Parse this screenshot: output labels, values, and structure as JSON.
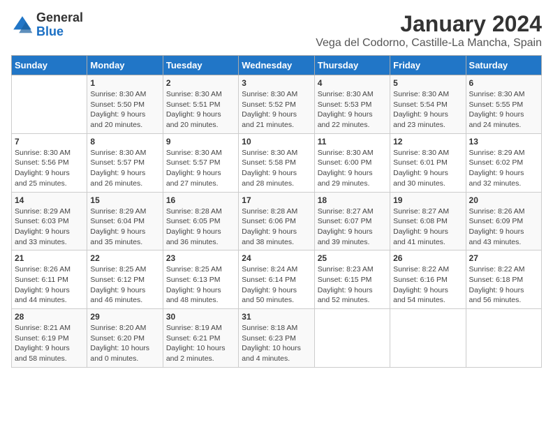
{
  "logo": {
    "line1": "General",
    "line2": "Blue"
  },
  "title": "January 2024",
  "subtitle": "Vega del Codorno, Castille-La Mancha, Spain",
  "weekdays": [
    "Sunday",
    "Monday",
    "Tuesday",
    "Wednesday",
    "Thursday",
    "Friday",
    "Saturday"
  ],
  "weeks": [
    [
      {
        "day": "",
        "sunrise": "",
        "sunset": "",
        "daylight": ""
      },
      {
        "day": "1",
        "sunrise": "Sunrise: 8:30 AM",
        "sunset": "Sunset: 5:50 PM",
        "daylight": "Daylight: 9 hours and 20 minutes."
      },
      {
        "day": "2",
        "sunrise": "Sunrise: 8:30 AM",
        "sunset": "Sunset: 5:51 PM",
        "daylight": "Daylight: 9 hours and 20 minutes."
      },
      {
        "day": "3",
        "sunrise": "Sunrise: 8:30 AM",
        "sunset": "Sunset: 5:52 PM",
        "daylight": "Daylight: 9 hours and 21 minutes."
      },
      {
        "day": "4",
        "sunrise": "Sunrise: 8:30 AM",
        "sunset": "Sunset: 5:53 PM",
        "daylight": "Daylight: 9 hours and 22 minutes."
      },
      {
        "day": "5",
        "sunrise": "Sunrise: 8:30 AM",
        "sunset": "Sunset: 5:54 PM",
        "daylight": "Daylight: 9 hours and 23 minutes."
      },
      {
        "day": "6",
        "sunrise": "Sunrise: 8:30 AM",
        "sunset": "Sunset: 5:55 PM",
        "daylight": "Daylight: 9 hours and 24 minutes."
      }
    ],
    [
      {
        "day": "7",
        "sunrise": "Sunrise: 8:30 AM",
        "sunset": "Sunset: 5:56 PM",
        "daylight": "Daylight: 9 hours and 25 minutes."
      },
      {
        "day": "8",
        "sunrise": "Sunrise: 8:30 AM",
        "sunset": "Sunset: 5:57 PM",
        "daylight": "Daylight: 9 hours and 26 minutes."
      },
      {
        "day": "9",
        "sunrise": "Sunrise: 8:30 AM",
        "sunset": "Sunset: 5:57 PM",
        "daylight": "Daylight: 9 hours and 27 minutes."
      },
      {
        "day": "10",
        "sunrise": "Sunrise: 8:30 AM",
        "sunset": "Sunset: 5:58 PM",
        "daylight": "Daylight: 9 hours and 28 minutes."
      },
      {
        "day": "11",
        "sunrise": "Sunrise: 8:30 AM",
        "sunset": "Sunset: 6:00 PM",
        "daylight": "Daylight: 9 hours and 29 minutes."
      },
      {
        "day": "12",
        "sunrise": "Sunrise: 8:30 AM",
        "sunset": "Sunset: 6:01 PM",
        "daylight": "Daylight: 9 hours and 30 minutes."
      },
      {
        "day": "13",
        "sunrise": "Sunrise: 8:29 AM",
        "sunset": "Sunset: 6:02 PM",
        "daylight": "Daylight: 9 hours and 32 minutes."
      }
    ],
    [
      {
        "day": "14",
        "sunrise": "Sunrise: 8:29 AM",
        "sunset": "Sunset: 6:03 PM",
        "daylight": "Daylight: 9 hours and 33 minutes."
      },
      {
        "day": "15",
        "sunrise": "Sunrise: 8:29 AM",
        "sunset": "Sunset: 6:04 PM",
        "daylight": "Daylight: 9 hours and 35 minutes."
      },
      {
        "day": "16",
        "sunrise": "Sunrise: 8:28 AM",
        "sunset": "Sunset: 6:05 PM",
        "daylight": "Daylight: 9 hours and 36 minutes."
      },
      {
        "day": "17",
        "sunrise": "Sunrise: 8:28 AM",
        "sunset": "Sunset: 6:06 PM",
        "daylight": "Daylight: 9 hours and 38 minutes."
      },
      {
        "day": "18",
        "sunrise": "Sunrise: 8:27 AM",
        "sunset": "Sunset: 6:07 PM",
        "daylight": "Daylight: 9 hours and 39 minutes."
      },
      {
        "day": "19",
        "sunrise": "Sunrise: 8:27 AM",
        "sunset": "Sunset: 6:08 PM",
        "daylight": "Daylight: 9 hours and 41 minutes."
      },
      {
        "day": "20",
        "sunrise": "Sunrise: 8:26 AM",
        "sunset": "Sunset: 6:09 PM",
        "daylight": "Daylight: 9 hours and 43 minutes."
      }
    ],
    [
      {
        "day": "21",
        "sunrise": "Sunrise: 8:26 AM",
        "sunset": "Sunset: 6:11 PM",
        "daylight": "Daylight: 9 hours and 44 minutes."
      },
      {
        "day": "22",
        "sunrise": "Sunrise: 8:25 AM",
        "sunset": "Sunset: 6:12 PM",
        "daylight": "Daylight: 9 hours and 46 minutes."
      },
      {
        "day": "23",
        "sunrise": "Sunrise: 8:25 AM",
        "sunset": "Sunset: 6:13 PM",
        "daylight": "Daylight: 9 hours and 48 minutes."
      },
      {
        "day": "24",
        "sunrise": "Sunrise: 8:24 AM",
        "sunset": "Sunset: 6:14 PM",
        "daylight": "Daylight: 9 hours and 50 minutes."
      },
      {
        "day": "25",
        "sunrise": "Sunrise: 8:23 AM",
        "sunset": "Sunset: 6:15 PM",
        "daylight": "Daylight: 9 hours and 52 minutes."
      },
      {
        "day": "26",
        "sunrise": "Sunrise: 8:22 AM",
        "sunset": "Sunset: 6:16 PM",
        "daylight": "Daylight: 9 hours and 54 minutes."
      },
      {
        "day": "27",
        "sunrise": "Sunrise: 8:22 AM",
        "sunset": "Sunset: 6:18 PM",
        "daylight": "Daylight: 9 hours and 56 minutes."
      }
    ],
    [
      {
        "day": "28",
        "sunrise": "Sunrise: 8:21 AM",
        "sunset": "Sunset: 6:19 PM",
        "daylight": "Daylight: 9 hours and 58 minutes."
      },
      {
        "day": "29",
        "sunrise": "Sunrise: 8:20 AM",
        "sunset": "Sunset: 6:20 PM",
        "daylight": "Daylight: 10 hours and 0 minutes."
      },
      {
        "day": "30",
        "sunrise": "Sunrise: 8:19 AM",
        "sunset": "Sunset: 6:21 PM",
        "daylight": "Daylight: 10 hours and 2 minutes."
      },
      {
        "day": "31",
        "sunrise": "Sunrise: 8:18 AM",
        "sunset": "Sunset: 6:23 PM",
        "daylight": "Daylight: 10 hours and 4 minutes."
      },
      {
        "day": "",
        "sunrise": "",
        "sunset": "",
        "daylight": ""
      },
      {
        "day": "",
        "sunrise": "",
        "sunset": "",
        "daylight": ""
      },
      {
        "day": "",
        "sunrise": "",
        "sunset": "",
        "daylight": ""
      }
    ]
  ]
}
